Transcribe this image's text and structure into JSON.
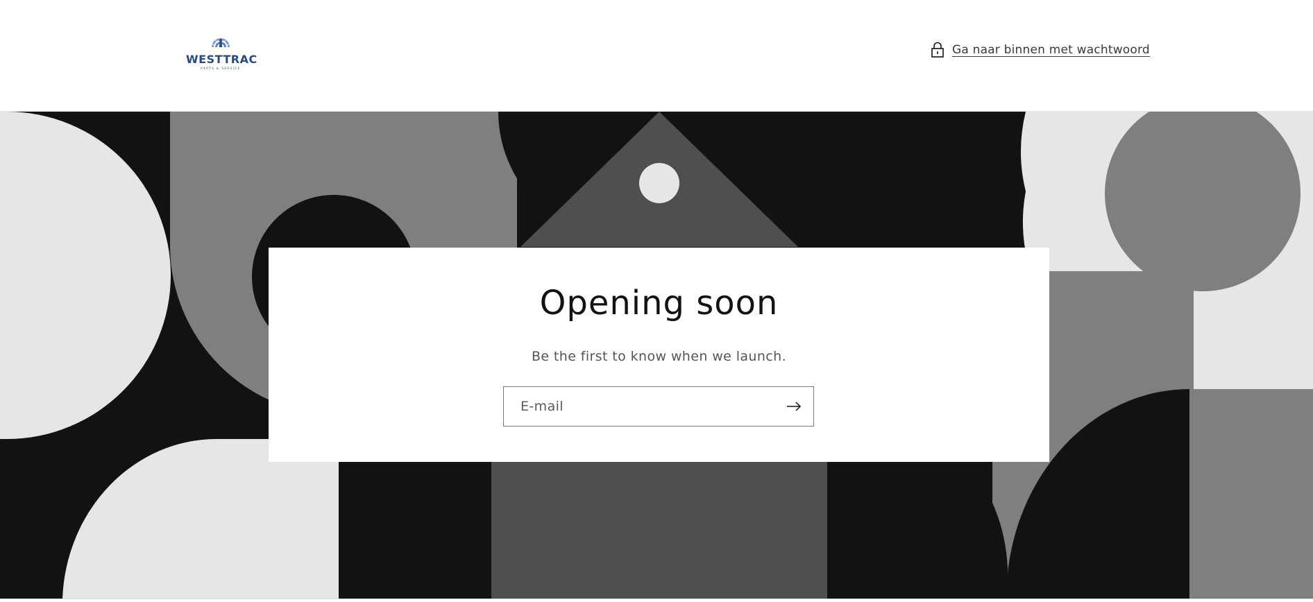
{
  "header": {
    "logo": {
      "brand": "WESTTRAC",
      "tagline": "PARTS & SERVICE",
      "icon": "peacock-fan-logo-icon",
      "color": "#2a4a7c"
    },
    "password_link": {
      "label": "Ga naar binnen met wachtwoord",
      "icon": "lock-icon"
    }
  },
  "main": {
    "title": "Opening soon",
    "subtitle": "Be the first to know when we launch.",
    "email_form": {
      "placeholder": "E-mail",
      "value": "",
      "submit_icon": "arrow-right-icon"
    }
  },
  "colors": {
    "black": "#121212",
    "dark_gray": "#4f4f4f",
    "mid_gray": "#7f7f7f",
    "light_gray": "#e6e6e6",
    "white": "#ffffff"
  }
}
